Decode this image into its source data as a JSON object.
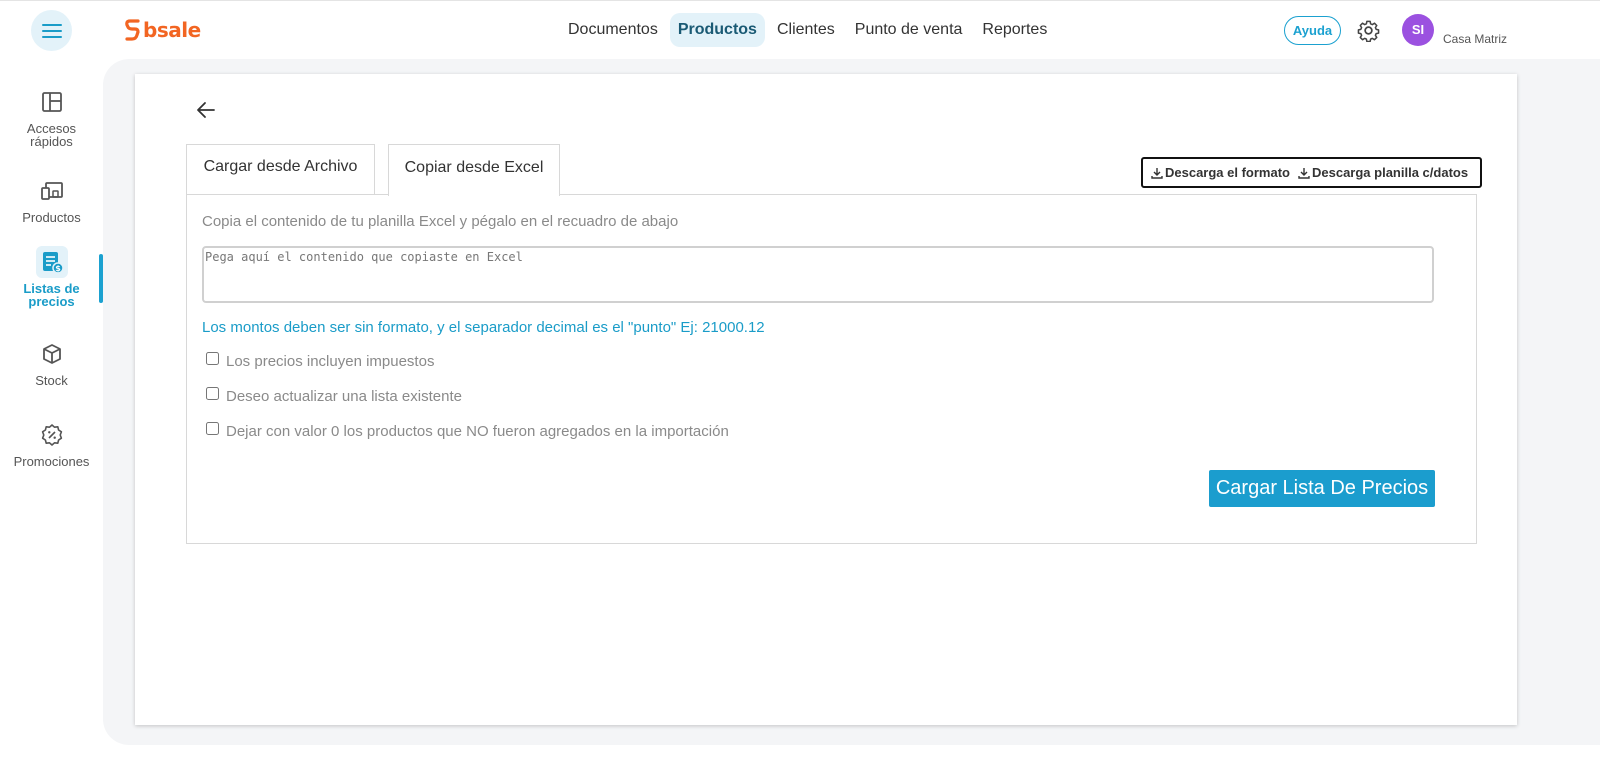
{
  "brand": {
    "logo_text": "bsale",
    "logo_color": "#f26522"
  },
  "topnav": {
    "items": [
      {
        "label": "Documentos",
        "active": false
      },
      {
        "label": "Productos",
        "active": true
      },
      {
        "label": "Clientes",
        "active": false
      },
      {
        "label": "Punto de venta",
        "active": false
      },
      {
        "label": "Reportes",
        "active": false
      }
    ]
  },
  "header": {
    "help_label": "Ayuda",
    "avatar_initials": "SI",
    "avatar_color": "#9b51e0",
    "branch_label": "Casa Matriz"
  },
  "sidebar": {
    "items": [
      {
        "label_line1": "Accesos",
        "label_line2": "rápidos",
        "icon": "layout-icon"
      },
      {
        "label_line1": "Productos",
        "label_line2": "",
        "icon": "devices-icon"
      },
      {
        "label_line1": "Listas de",
        "label_line2": "precios",
        "icon": "price-list-icon",
        "active": true
      },
      {
        "label_line1": "Stock",
        "label_line2": "",
        "icon": "box-icon"
      },
      {
        "label_line1": "Promociones",
        "label_line2": "",
        "icon": "discount-icon"
      }
    ]
  },
  "tabs": [
    {
      "label": "Cargar desde Archivo",
      "active": false
    },
    {
      "label": "Copiar desde Excel",
      "active": true
    }
  ],
  "downloads": {
    "format_label": "Descarga el formato",
    "with_data_label": "Descarga planilla c/datos"
  },
  "form": {
    "instruction": "Copia el contenido de tu planilla Excel y pégalo en el recuadro de abajo",
    "paste_placeholder": "Pega aquí el contenido que copiaste en Excel",
    "paste_value": "",
    "amount_note": "Los montos deben ser sin formato, y el separador decimal es el \"punto\" Ej: 21000.12",
    "checkboxes": [
      {
        "label": "Los precios incluyen impuestos",
        "checked": false
      },
      {
        "label": "Deseo actualizar una lista existente",
        "checked": false
      },
      {
        "label": "Dejar con valor 0 los productos que NO fueron agregados en la importación",
        "checked": false
      }
    ],
    "submit_label": "Cargar Lista De Precios"
  },
  "colors": {
    "accent": "#1ba1d0",
    "accent_dark": "#1a5a74",
    "button": "#1b9dce"
  }
}
